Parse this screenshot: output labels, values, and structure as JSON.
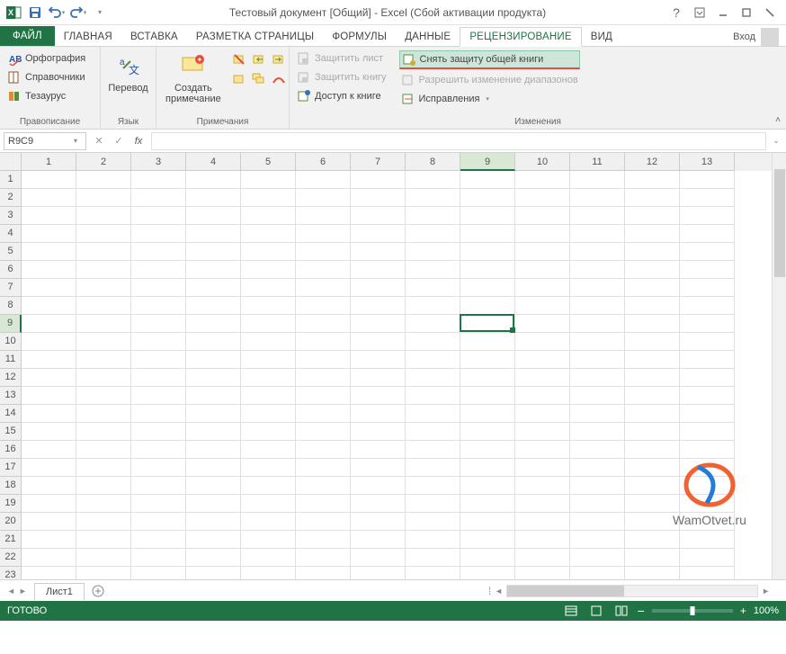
{
  "title": "Тестовый документ  [Общий] - Excel (Сбой активации продукта)",
  "login": "Вход",
  "tabs": {
    "file": "ФАЙЛ",
    "home": "ГЛАВНАЯ",
    "insert": "ВСТАВКА",
    "page_layout": "РАЗМЕТКА СТРАНИЦЫ",
    "formulas": "ФОРМУЛЫ",
    "data": "ДАННЫЕ",
    "review": "РЕЦЕНЗИРОВАНИЕ",
    "view": "ВИД"
  },
  "ribbon": {
    "proofing": {
      "spelling": "Орфография",
      "research": "Справочники",
      "thesaurus": "Тезаурус",
      "label": "Правописание"
    },
    "language": {
      "translate": "Перевод",
      "label": "Язык"
    },
    "comments": {
      "new": "Создать примечание",
      "label": "Примечания"
    },
    "changes": {
      "protect_sheet": "Защитить лист",
      "protect_workbook": "Защитить книгу",
      "share_workbook": "Доступ к книге",
      "unprotect_shared": "Снять защиту общей книги",
      "allow_ranges": "Разрешить изменение диапазонов",
      "track_changes": "Исправления",
      "label": "Изменения"
    }
  },
  "namebox": "R9C9",
  "fx_label": "fx",
  "columns": [
    "1",
    "2",
    "3",
    "4",
    "5",
    "6",
    "7",
    "8",
    "9",
    "10",
    "11",
    "12",
    "13"
  ],
  "rows": [
    "1",
    "2",
    "3",
    "4",
    "5",
    "6",
    "7",
    "8",
    "9",
    "10",
    "11",
    "12",
    "13",
    "14",
    "15",
    "16",
    "17",
    "18",
    "19",
    "20",
    "21",
    "22",
    "23"
  ],
  "selected": {
    "row": 9,
    "col": 9
  },
  "sheet": "Лист1",
  "status": "ГОТОВО",
  "zoom": "100%",
  "watermark": "WamOtvet.ru"
}
